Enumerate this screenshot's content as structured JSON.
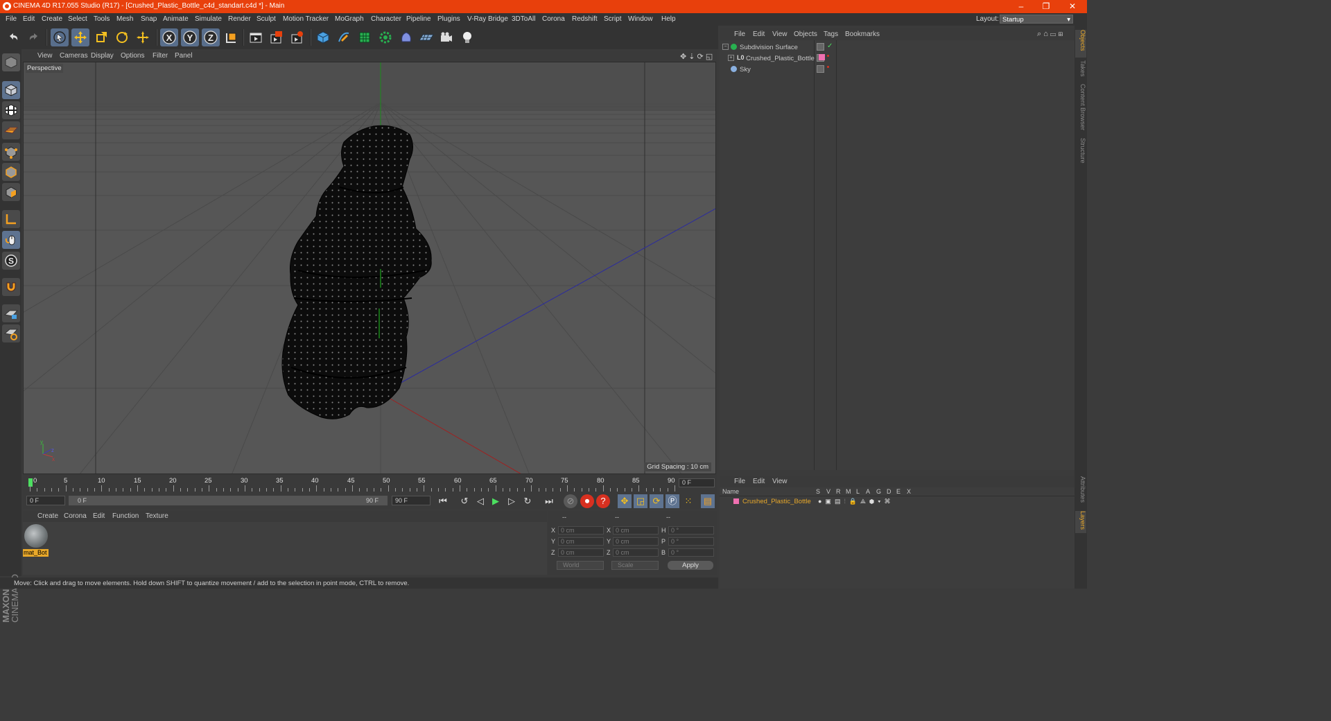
{
  "window": {
    "title": "CINEMA 4D R17.055 Studio (R17) - [Crushed_Plastic_Bottle_c4d_standart.c4d *] - Main",
    "minimize": "–",
    "maximize": "❐",
    "close": "✕"
  },
  "menubar": {
    "items": [
      "File",
      "Edit",
      "Create",
      "Select",
      "Tools",
      "Mesh",
      "Snap",
      "Animate",
      "Simulate",
      "Render",
      "Sculpt",
      "Motion Tracker",
      "MoGraph",
      "Character",
      "Pipeline",
      "Plugins",
      "V-Ray Bridge",
      "3DToAll",
      "Corona",
      "Redshift",
      "Script",
      "Window",
      "Help"
    ],
    "layout_label": "Layout:",
    "layout_value": "Startup"
  },
  "toolbar": {
    "icons": [
      "undo-icon",
      "redo-icon",
      "select-live-icon",
      "move-icon",
      "scale-icon",
      "rotate-icon",
      "move-alt-icon",
      "x-axis-icon",
      "y-axis-icon",
      "z-axis-icon",
      "coordinate-system-icon",
      "render-view-icon",
      "render-picture-viewer-icon",
      "edit-render-settings-icon",
      "cube-icon",
      "pen-icon",
      "subdivision-icon",
      "array-icon",
      "deformer-icon",
      "floor-icon",
      "camera-icon",
      "light-icon"
    ]
  },
  "viewport": {
    "menu": [
      "View",
      "Cameras",
      "Display",
      "Options",
      "Filter",
      "Panel"
    ],
    "camera_label": "Perspective",
    "grid_spacing": "Grid Spacing : 10 cm"
  },
  "timeline": {
    "ticks": [
      "0",
      "5",
      "10",
      "15",
      "20",
      "25",
      "30",
      "35",
      "40",
      "45",
      "50",
      "55",
      "60",
      "65",
      "70",
      "75",
      "80",
      "85",
      "90"
    ],
    "current_frame": "0 F",
    "start_field": "0 F",
    "range_start": "0 F",
    "range_end": "90 F",
    "end_field": "90 F"
  },
  "material_manager": {
    "menu": [
      "Create",
      "Corona",
      "Edit",
      "Function",
      "Texture"
    ],
    "materials": [
      {
        "name": "mat_Bot"
      }
    ]
  },
  "coordinates": {
    "header": [
      "--",
      "--",
      "--"
    ],
    "rows": [
      {
        "a": "X",
        "a_val": "0 cm",
        "b": "X",
        "b_val": "0 cm",
        "c": "H",
        "c_val": "0 °"
      },
      {
        "a": "Y",
        "a_val": "0 cm",
        "b": "Y",
        "b_val": "0 cm",
        "c": "P",
        "c_val": "0 °"
      },
      {
        "a": "Z",
        "a_val": "0 cm",
        "b": "Z",
        "b_val": "0 cm",
        "c": "B",
        "c_val": "0 °"
      }
    ],
    "mode": "World",
    "transform": "Scale",
    "apply": "Apply"
  },
  "status": {
    "text": "Move: Click and drag to move elements. Hold down SHIFT to quantize movement / add to the selection in point mode, CTRL to remove."
  },
  "object_manager": {
    "menu": [
      "File",
      "Edit",
      "View",
      "Objects",
      "Tags",
      "Bookmarks"
    ],
    "objects": [
      {
        "name": "Subdivision Surface",
        "icon": "subdivision-icon"
      },
      {
        "name": "Crushed_Plastic_Bottle",
        "icon": "null-object-icon",
        "tag_color": "#f070b0"
      },
      {
        "name": "Sky",
        "icon": "sky-icon"
      }
    ]
  },
  "layer_manager": {
    "menu": [
      "File",
      "Edit",
      "View"
    ],
    "columns": [
      "Name",
      "S",
      "V",
      "R",
      "M",
      "L",
      "A",
      "G",
      "D",
      "E",
      "X"
    ],
    "layers": [
      {
        "name": "Crushed_Plastic_Bottle",
        "color": "#f070b0"
      }
    ]
  },
  "side_tabs": {
    "top": [
      "Objects",
      "Takes",
      "Content Browser",
      "Structure"
    ],
    "bottom": [
      "Attributes",
      "Layers"
    ]
  },
  "colors": {
    "title_bar": "#e8400c",
    "accent": "#e8a82a",
    "selection_blue": "#5e7390"
  }
}
